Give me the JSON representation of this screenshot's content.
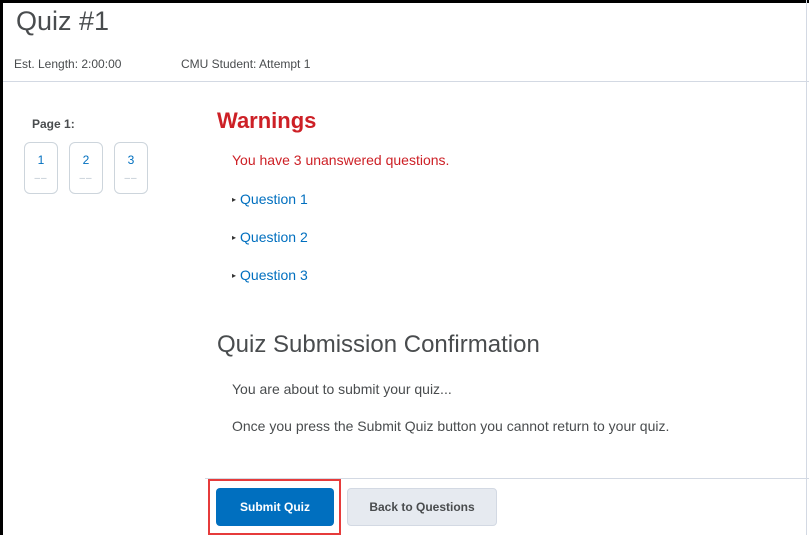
{
  "header": {
    "title": "Quiz #1",
    "est_length": "Est. Length: 2:00:00",
    "attempt": "CMU Student: Attempt 1"
  },
  "sidebar": {
    "page_label": "Page 1:",
    "pages": [
      {
        "number": "1",
        "status": "––"
      },
      {
        "number": "2",
        "status": "––"
      },
      {
        "number": "3",
        "status": "––"
      }
    ]
  },
  "warnings": {
    "title": "Warnings",
    "message": "You have 3 unanswered questions.",
    "questions": [
      "Question 1",
      "Question 2",
      "Question 3"
    ]
  },
  "confirmation": {
    "title": "Quiz Submission Confirmation",
    "line1": "You are about to submit your quiz...",
    "line2": "Once you press the Submit Quiz button you cannot return to your quiz."
  },
  "actions": {
    "submit_label": "Submit Quiz",
    "back_label": "Back to Questions"
  },
  "colors": {
    "warning_red": "#cd2026",
    "link_blue": "#006fbf",
    "highlight_red": "#e63b3b"
  }
}
